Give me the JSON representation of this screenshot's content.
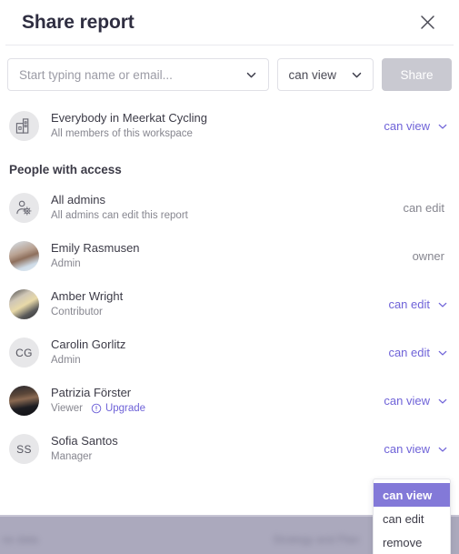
{
  "dialog": {
    "title": "Share report",
    "close_icon": "close-icon"
  },
  "share_form": {
    "search_placeholder": "Start typing name or email...",
    "search_value": "",
    "permission_value": "can view",
    "share_button": "Share",
    "share_button_disabled": true
  },
  "workspace": {
    "name": "Everybody in Meerkat Cycling",
    "subtitle": "All members of this workspace",
    "permission": "can view",
    "icon": "office-building-icon"
  },
  "section": {
    "heading": "People with access"
  },
  "people": [
    {
      "name": "All admins",
      "subtitle": "All admins can edit this report",
      "permission": "can edit",
      "interactive": false,
      "avatar_type": "icon",
      "avatar_icon": "person-gear-icon",
      "initials": ""
    },
    {
      "name": "Emily Rasmusen",
      "subtitle": "Admin",
      "permission": "owner",
      "interactive": false,
      "avatar_type": "photo",
      "avatar_icon": "user-photo",
      "initials": ""
    },
    {
      "name": "Amber Wright",
      "subtitle": "Contributor",
      "permission": "can edit",
      "interactive": true,
      "avatar_type": "photo",
      "avatar_icon": "user-photo",
      "initials": ""
    },
    {
      "name": "Carolin Gorlitz",
      "subtitle": "Admin",
      "permission": "can edit",
      "interactive": true,
      "avatar_type": "initials",
      "avatar_icon": "initials-avatar",
      "initials": "CG"
    },
    {
      "name": "Patrizia Förster",
      "subtitle": "Viewer",
      "badge": "Upgrade",
      "badge_icon": "alert-circle-icon",
      "permission": "can view",
      "interactive": true,
      "avatar_type": "photo",
      "avatar_icon": "user-photo",
      "initials": ""
    },
    {
      "name": "Sofia Santos",
      "subtitle": "Manager",
      "permission": "can view",
      "interactive": true,
      "avatar_type": "initials",
      "avatar_icon": "initials-avatar",
      "initials": "SS"
    }
  ],
  "dropdown": {
    "open": true,
    "items": [
      {
        "label": "can view",
        "selected": true
      },
      {
        "label": "can edit",
        "selected": false
      },
      {
        "label": "remove",
        "selected": false
      }
    ]
  },
  "backdrop": {
    "left_text": "ne data",
    "right_text": "Strategy and Plan"
  },
  "colors": {
    "accent": "#6f63d8",
    "accent_selected": "#8379d8",
    "title": "#2f2e41",
    "muted": "#86868f",
    "disabled_button": "#c9c9d1",
    "border": "#e0e0e6",
    "avatar_bg": "#e7e7e9",
    "backdrop": "#aba9bd"
  }
}
